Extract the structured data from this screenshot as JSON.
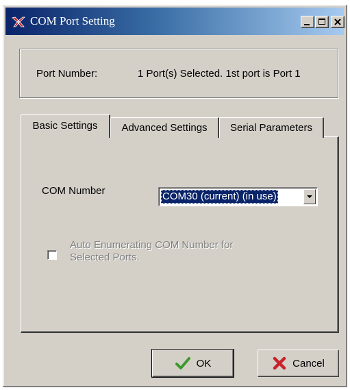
{
  "window": {
    "title": "COM Port Setting",
    "title_font": "serif",
    "controls": [
      "minimize-icon",
      "maximize-icon",
      "close-icon"
    ]
  },
  "port_info": {
    "label": "Port Number:",
    "value": "1 Port(s) Selected. 1st port is Port 1"
  },
  "tabs": [
    {
      "label": "Basic Settings",
      "active": true
    },
    {
      "label": "Advanced Settings",
      "active": false
    },
    {
      "label": "Serial Parameters",
      "active": false
    }
  ],
  "basic": {
    "com_label": "COM Number",
    "com_value": "COM30 (current) (in use)",
    "auto_enum_label": "Auto Enumerating COM Number for Selected Ports.",
    "auto_enum_checked": false,
    "auto_enum_enabled": false
  },
  "buttons": {
    "ok": {
      "label": "OK",
      "icon": "checkmark-icon"
    },
    "cancel": {
      "label": "Cancel",
      "icon": "x-icon"
    }
  },
  "colors": {
    "title_gradient_start": "#0a246a",
    "title_gradient_end": "#a6caf0",
    "face": "#d4d0c8",
    "selection": "#0a246a",
    "ok_icon": "#3c9a2a",
    "cancel_icon": "#c8232c"
  }
}
